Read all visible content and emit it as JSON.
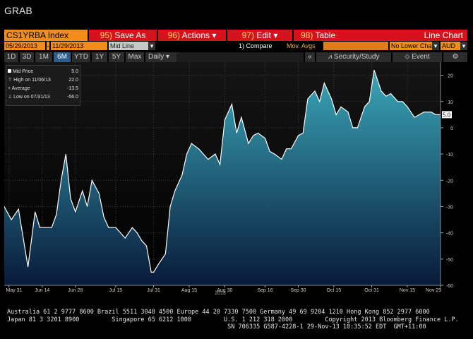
{
  "title": "GRAB",
  "header": {
    "ticker": "CS1YRBA Index",
    "menus": [
      {
        "num": "95)",
        "label": "Save As"
      },
      {
        "num": "96)",
        "label": "Actions",
        "dropdown": true
      },
      {
        "num": "97)",
        "label": "Edit",
        "dropdown": true
      },
      {
        "num": "98)",
        "label": "Table"
      }
    ],
    "view_title": "Line Chart"
  },
  "fields": {
    "start_date": "05/29/2013",
    "end_date": "11/29/2013",
    "mid_line": "Mid Line",
    "compare": "1) Compare",
    "mov_avgs": "Mov. Avgs",
    "lower_chart": "No Lower Chart",
    "currency": "AUD"
  },
  "toolbar": {
    "ranges": [
      "1D",
      "3D",
      "1M",
      "6M",
      "YTD",
      "1Y",
      "5Y",
      "Max"
    ],
    "active_range": "6M",
    "period": "Daily",
    "security_study": "Security/Study",
    "event": "Event"
  },
  "legend": {
    "rows": [
      {
        "label": "Mid Price",
        "value": "5.0"
      },
      {
        "label": "High on 11/06/13",
        "value": "22.0"
      },
      {
        "label": "Average",
        "value": "-13.5"
      },
      {
        "label": "Low on 07/31/13",
        "value": "-56.0"
      }
    ]
  },
  "colors": {
    "accent_orange": "#f28c1b",
    "menu_red": "#d6131c",
    "line": "#ffffff",
    "fill_top": "#3aa6b8",
    "fill_bottom": "#081a3a"
  },
  "chart_data": {
    "type": "area",
    "series": [
      {
        "x": [
          "2013-05-29",
          "2013-06-01",
          "2013-06-04",
          "2013-06-06",
          "2013-06-08",
          "2013-06-11",
          "2013-06-13",
          "2013-06-15",
          "2013-06-18",
          "2013-06-20",
          "2013-06-22",
          "2013-06-24",
          "2013-06-26",
          "2013-06-28",
          "2013-07-01",
          "2013-07-03",
          "2013-07-05",
          "2013-07-08",
          "2013-07-10",
          "2013-07-12",
          "2013-07-15",
          "2013-07-17",
          "2013-07-19",
          "2013-07-22",
          "2013-07-24",
          "2013-07-26",
          "2013-07-28",
          "2013-07-30",
          "2013-07-31",
          "2013-08-02",
          "2013-08-05",
          "2013-08-07",
          "2013-08-09",
          "2013-08-12",
          "2013-08-14",
          "2013-08-16",
          "2013-08-19",
          "2013-08-21",
          "2013-08-23",
          "2013-08-26",
          "2013-08-28",
          "2013-08-30",
          "2013-09-02",
          "2013-09-04",
          "2013-09-06",
          "2013-09-09",
          "2013-09-11",
          "2013-09-13",
          "2013-09-16",
          "2013-09-18",
          "2013-09-20",
          "2013-09-23",
          "2013-09-25",
          "2013-09-27",
          "2013-09-30",
          "2013-10-02",
          "2013-10-04",
          "2013-10-07",
          "2013-10-09",
          "2013-10-11",
          "2013-10-14",
          "2013-10-16",
          "2013-10-18",
          "2013-10-21",
          "2013-10-23",
          "2013-10-25",
          "2013-10-28",
          "2013-10-30",
          "2013-11-01",
          "2013-11-04",
          "2013-11-06",
          "2013-11-08",
          "2013-11-11",
          "2013-11-13",
          "2013-11-15",
          "2013-11-18",
          "2013-11-20",
          "2013-11-22",
          "2013-11-25",
          "2013-11-27",
          "2013-11-29"
        ],
        "values": [
          -30,
          -35,
          -31,
          -42,
          -53,
          -32,
          -38,
          -38,
          -38,
          -33,
          -20,
          -10,
          -27,
          -32,
          -24,
          -30,
          -20,
          -25,
          -34,
          -38,
          -38,
          -40,
          -42,
          -38,
          -40,
          -43,
          -45,
          -55,
          -55,
          -52,
          -48,
          -30,
          -24,
          -18,
          -10,
          -6,
          -8,
          -10,
          -12,
          -10,
          -14,
          3,
          9,
          -2,
          4,
          -6,
          -3,
          -2,
          -4,
          -9,
          -10,
          -12,
          -8,
          -8,
          -3,
          -2,
          11,
          14,
          10,
          17,
          11,
          5,
          8,
          6,
          0,
          0,
          8,
          10,
          22,
          14,
          12,
          13,
          10,
          10,
          8,
          4,
          5,
          6,
          6,
          5,
          5
        ]
      }
    ],
    "x_tick_labels": [
      "May 31",
      "Jun 14",
      "Jun 28",
      "Jul 15",
      "Jul 31",
      "Aug 15",
      "Aug 30",
      "Sep 16",
      "Sep 30",
      "Oct 15",
      "Oct 31",
      "Nov 15",
      "Nov 29"
    ],
    "x_tick_dates": [
      "2013-05-31",
      "2013-06-14",
      "2013-06-28",
      "2013-07-15",
      "2013-07-31",
      "2013-08-15",
      "2013-08-30",
      "2013-09-16",
      "2013-09-30",
      "2013-10-15",
      "2013-10-31",
      "2013-11-15",
      "2013-11-29"
    ],
    "year_label": "2013",
    "y_ticks": [
      20,
      10,
      0,
      -10,
      -20,
      -30,
      -40,
      -50,
      -60
    ],
    "ylim": [
      -60,
      25
    ],
    "last_value_label": "5.0",
    "grid": true
  },
  "footer": {
    "line1": "Australia 61 2 9777 8600 Brazil 5511 3048 4500 Europe 44 20 7330 7500 Germany 49 69 9204 1210 Hong Kong 852 2977 6000",
    "line2": "Japan 81 3 3201 8900         Singapore 65 6212 1000         U.S. 1 212 318 2000         Copyright 2013 Bloomberg Finance L.P.",
    "line3": "                                                             SN 706335 G587-4228-1 29-Nov-13 10:35:52 EDT  GMT+11:00"
  }
}
